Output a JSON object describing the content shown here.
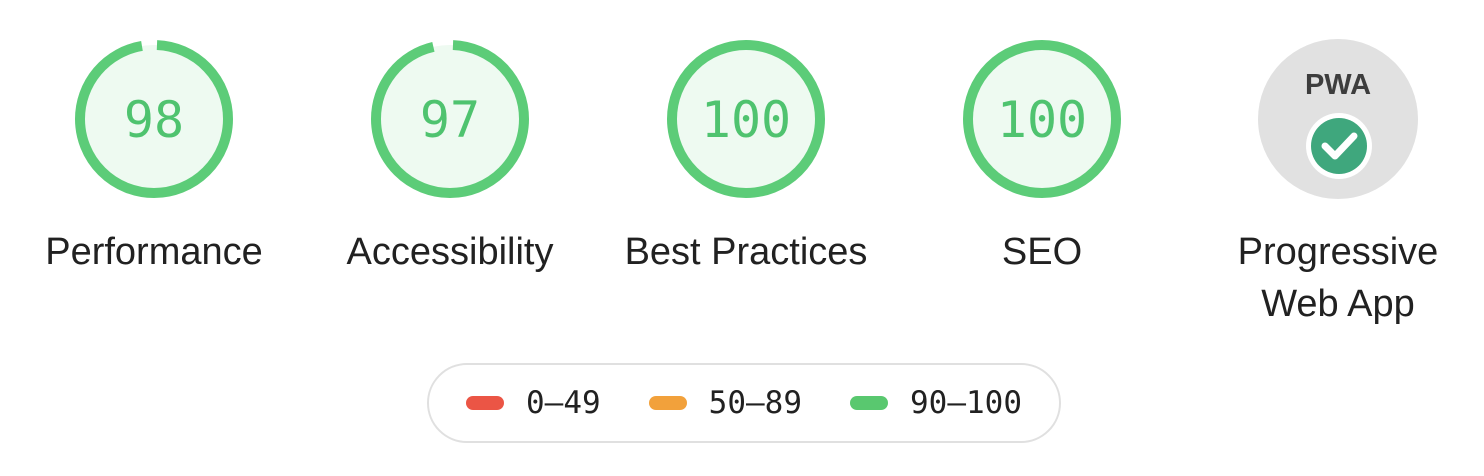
{
  "gauges": [
    {
      "label": "Performance",
      "score": "98",
      "value": 98
    },
    {
      "label": "Accessibility",
      "score": "97",
      "value": 97
    },
    {
      "label": "Best Practices",
      "score": "100",
      "value": 100
    },
    {
      "label": "SEO",
      "score": "100",
      "value": 100
    }
  ],
  "pwa": {
    "badge_text": "PWA",
    "label_line1": "Progressive",
    "label_line2": "Web App"
  },
  "legend": {
    "items": [
      {
        "range": "0–49",
        "color": "#eb5545"
      },
      {
        "range": "50–89",
        "color": "#f2a13b"
      },
      {
        "range": "90–100",
        "color": "#59c86f"
      }
    ]
  },
  "colors": {
    "pass_ring": "#5ccc78",
    "pass_fill": "#eefaf1",
    "pass_text": "#4fc36f",
    "pwa_bg": "#e1e1e1",
    "check_badge": "#3fa77d"
  }
}
